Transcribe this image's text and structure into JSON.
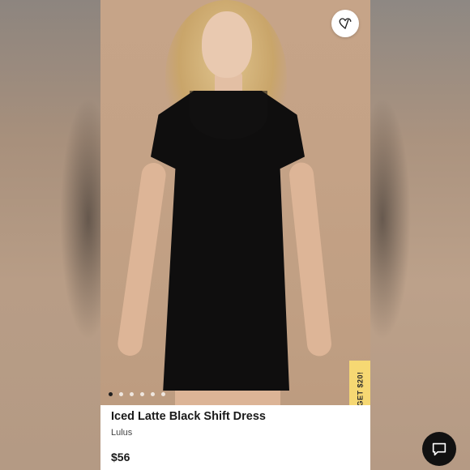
{
  "product": {
    "title": "Iced Latte Black Shift Dress",
    "brand": "Lulus",
    "price": "$56"
  },
  "promo": {
    "label": "GET $20!"
  },
  "carousel": {
    "count": 6,
    "active_index": 0
  },
  "icons": {
    "like": "heart-icon",
    "chat": "chat-icon"
  },
  "colors": {
    "promo_bg": "#f6d873",
    "chat_bg": "#111111",
    "dress": "#0f0e0e"
  }
}
